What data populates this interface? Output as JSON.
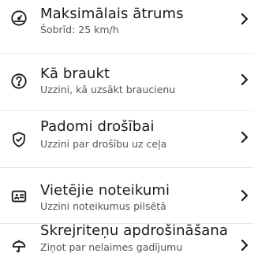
{
  "menu": {
    "items": [
      {
        "title": "Maksimālais ātrums",
        "subtitle": "Šobrīd: 25 km/h",
        "icon": "speedometer-icon"
      },
      {
        "title": "Kā braukt",
        "subtitle": "Uzzini, kā uzsākt braucienu",
        "icon": "help-circle-icon"
      },
      {
        "title": "Padomi drošībai",
        "subtitle": "Uzzini par drošību uz ceļa",
        "icon": "shield-check-icon"
      },
      {
        "title": "Vietējie noteikumi",
        "subtitle": "Uzzini noteikumus pilsētā",
        "icon": "id-card-icon"
      },
      {
        "title": "Skrejriteņu apdrošināšana",
        "subtitle": "Ziņot par nelaimes gadījumu",
        "icon": "umbrella-icon"
      }
    ]
  },
  "colors": {
    "text_primary": "#1c1c1c",
    "text_secondary": "#555555",
    "divider": "#e8e8e8",
    "background": "#ffffff"
  }
}
